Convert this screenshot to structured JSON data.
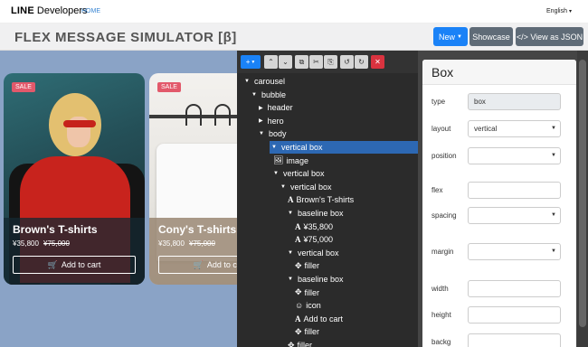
{
  "topbar": {
    "logo_line": "LINE",
    "logo_rest": "Developers",
    "home": "HOME",
    "language": "English"
  },
  "header": {
    "title": "FLEX MESSAGE SIMULATOR [β]",
    "new_label": "New",
    "showcase_label": "Showcase",
    "json_label": "</> View as JSON"
  },
  "preview": {
    "cards": [
      {
        "badge": "SALE",
        "name": "Brown's T-shirts",
        "price": "¥35,800",
        "old_price": "¥75,000",
        "button": "Add to cart"
      },
      {
        "badge": "SALE",
        "name": "Cony's T-shirts",
        "price": "¥35,800",
        "old_price": "¥75,000",
        "button": "Add to cart"
      }
    ]
  },
  "tree": {
    "nodes": [
      {
        "label": "carousel",
        "toggle": "▼",
        "icon": ""
      },
      {
        "label": "bubble",
        "toggle": "▼",
        "icon": ""
      },
      {
        "label": "header",
        "toggle": "▶",
        "icon": ""
      },
      {
        "label": "hero",
        "toggle": "▶",
        "icon": ""
      },
      {
        "label": "body",
        "toggle": "▼",
        "icon": ""
      },
      {
        "label": "vertical box",
        "toggle": "▼",
        "icon": ""
      },
      {
        "label": "image",
        "toggle": "",
        "icon": "image"
      },
      {
        "label": "vertical box",
        "toggle": "▼",
        "icon": ""
      },
      {
        "label": "vertical box",
        "toggle": "▼",
        "icon": ""
      },
      {
        "label": "Brown's T-shirts",
        "toggle": "",
        "icon": "text"
      },
      {
        "label": "baseline box",
        "toggle": "▼",
        "icon": ""
      },
      {
        "label": "¥35,800",
        "toggle": "",
        "icon": "text"
      },
      {
        "label": "¥75,000",
        "toggle": "",
        "icon": "text"
      },
      {
        "label": "vertical box",
        "toggle": "▼",
        "icon": ""
      },
      {
        "label": "filler",
        "toggle": "",
        "icon": "filler"
      },
      {
        "label": "baseline box",
        "toggle": "▼",
        "icon": ""
      },
      {
        "label": "filler",
        "toggle": "",
        "icon": "filler"
      },
      {
        "label": "icon",
        "toggle": "",
        "icon": "icon"
      },
      {
        "label": "Add to cart",
        "toggle": "",
        "icon": "text"
      },
      {
        "label": "filler",
        "toggle": "",
        "icon": "filler"
      },
      {
        "label": "filler",
        "toggle": "",
        "icon": "filler"
      }
    ]
  },
  "props": {
    "title": "Box",
    "rows": [
      {
        "label": "type",
        "value": "box",
        "kind": "readonly"
      },
      {
        "label": "layout",
        "value": "vertical",
        "kind": "select"
      },
      {
        "label": "position",
        "value": "",
        "kind": "select"
      },
      {
        "label": "flex",
        "value": "",
        "kind": "text"
      },
      {
        "label": "spacing",
        "value": "",
        "kind": "select"
      },
      {
        "label": "margin",
        "value": "",
        "kind": "select"
      },
      {
        "label": "width",
        "value": "",
        "kind": "text"
      },
      {
        "label": "height",
        "value": "",
        "kind": "text"
      },
      {
        "label": "backg",
        "value": "",
        "kind": "text"
      }
    ]
  },
  "colors": {
    "accent": "#1a82f7",
    "selected": "#2d68b3",
    "danger": "#d9333f",
    "sale": "#e2596b"
  }
}
